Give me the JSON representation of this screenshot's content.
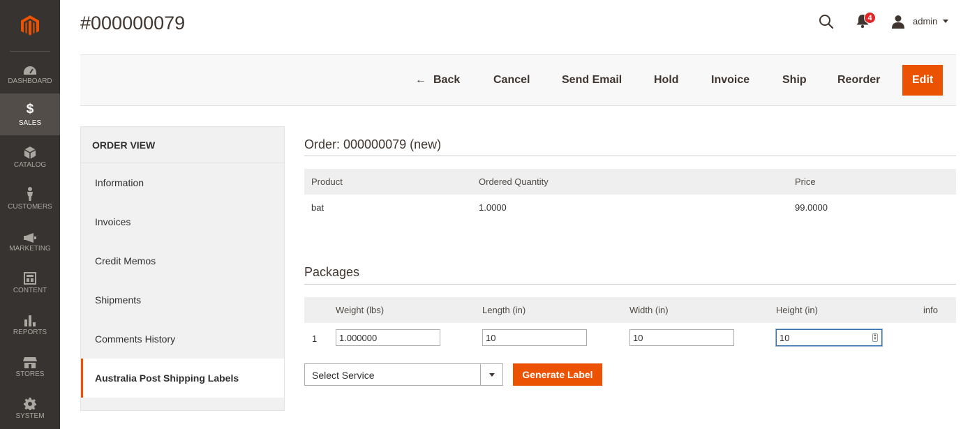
{
  "page": {
    "title": "#000000079"
  },
  "header": {
    "notification_count": "4",
    "user_name": "admin"
  },
  "nav": {
    "items": [
      {
        "label": "DASHBOARD",
        "icon": "dashboard-icon"
      },
      {
        "label": "SALES",
        "icon": "dollar-icon",
        "active": true
      },
      {
        "label": "CATALOG",
        "icon": "cube-icon"
      },
      {
        "label": "CUSTOMERS",
        "icon": "person-icon"
      },
      {
        "label": "MARKETING",
        "icon": "megaphone-icon"
      },
      {
        "label": "CONTENT",
        "icon": "layout-icon"
      },
      {
        "label": "REPORTS",
        "icon": "bar-chart-icon"
      },
      {
        "label": "STORES",
        "icon": "store-icon"
      },
      {
        "label": "SYSTEM",
        "icon": "gear-icon"
      }
    ]
  },
  "toolbar": {
    "back": "Back",
    "cancel": "Cancel",
    "send_email": "Send Email",
    "hold": "Hold",
    "invoice": "Invoice",
    "ship": "Ship",
    "reorder": "Reorder",
    "edit": "Edit"
  },
  "tabs": {
    "title": "ORDER VIEW",
    "items": [
      {
        "label": "Information"
      },
      {
        "label": "Invoices"
      },
      {
        "label": "Credit Memos"
      },
      {
        "label": "Shipments"
      },
      {
        "label": "Comments History"
      },
      {
        "label": "Australia Post Shipping Labels",
        "active": true
      }
    ]
  },
  "order": {
    "heading": "Order: 000000079 (new)",
    "columns": [
      "Product",
      "Ordered Quantity",
      "Price"
    ],
    "rows": [
      {
        "product": "bat",
        "quantity": "1.0000",
        "price": "99.0000"
      }
    ]
  },
  "packages": {
    "heading": "Packages",
    "columns": [
      "Weight (lbs)",
      "Length (in)",
      "Width (in)",
      "Height (in)",
      "info"
    ],
    "rows": [
      {
        "index": "1",
        "weight": "1.000000",
        "length": "10",
        "width": "10",
        "height": "10"
      }
    ],
    "service_select": "Select Service",
    "generate_label": "Generate Label"
  },
  "colors": {
    "accent": "#eb5202",
    "nav_bg": "#373330",
    "nav_active": "#524d49"
  }
}
